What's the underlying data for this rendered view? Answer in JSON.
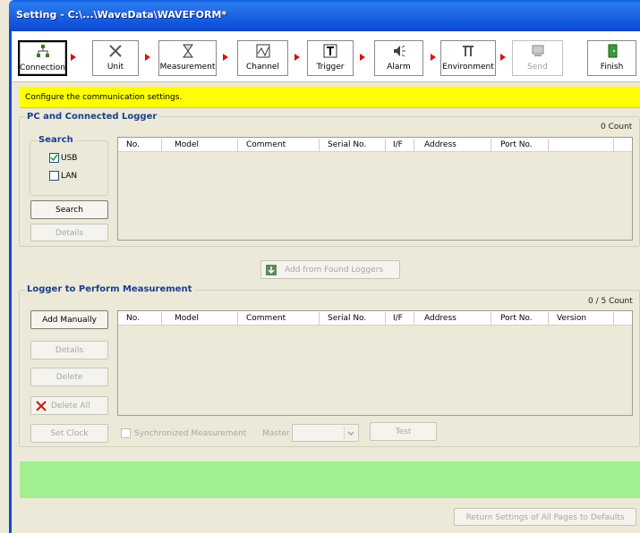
{
  "window": {
    "title": "Setting - C:\\...\\WaveData\\WAVEFORM*"
  },
  "toolbar": {
    "items": [
      {
        "label": "Connection",
        "icon": "network-icon"
      },
      {
        "label": "Unit",
        "icon": "tools-icon"
      },
      {
        "label": "Measurement",
        "icon": "hourglass-icon"
      },
      {
        "label": "Channel",
        "icon": "waveform-icon"
      },
      {
        "label": "Trigger",
        "icon": "trigger-icon"
      },
      {
        "label": "Alarm",
        "icon": "speaker-icon"
      },
      {
        "label": "Environment",
        "icon": "wrench-icon"
      },
      {
        "label": "Send",
        "icon": "send-icon"
      },
      {
        "label": "Finish",
        "icon": "door-icon"
      }
    ]
  },
  "info": {
    "message": "Configure the communication settings."
  },
  "pc_group": {
    "title": "PC and Connected Logger",
    "count": "0 Count",
    "search_group": {
      "title": "Search",
      "usb_label": "USB",
      "usb_checked": true,
      "lan_label": "LAN",
      "lan_checked": false
    },
    "search_button": "Search",
    "details_button": "Details",
    "columns": [
      "No.",
      "Model",
      "Comment",
      "Serial No.",
      "I/F",
      "Address",
      "Port No."
    ]
  },
  "add_from_found_button": "Add from Found Loggers",
  "logger_group": {
    "title": "Logger to Perform Measurement",
    "count": "0 / 5 Count",
    "add_manually_button": "Add Manually",
    "details_button": "Details",
    "delete_button": "Delete",
    "delete_all_button": "Delete All",
    "set_clock_button": "Set Clock",
    "sync_label": "Synchronized Measurement",
    "master_label": "Master",
    "test_button": "Test",
    "columns": [
      "No.",
      "Model",
      "Comment",
      "Serial No.",
      "I/F",
      "Address",
      "Port No.",
      "Version"
    ]
  },
  "return_defaults_button": "Return Settings of All Pages to Defaults",
  "colors": {
    "title_bar": "#1d63e3",
    "info_bar": "#ffff00",
    "status_bar": "#a0f090",
    "group_title": "#1a3f8f"
  }
}
